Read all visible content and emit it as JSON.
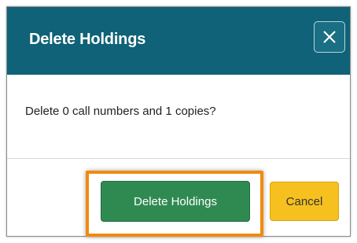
{
  "dialog": {
    "title": "Delete Holdings",
    "message": "Delete 0 call numbers and 1 copies?",
    "close_icon": "close-icon",
    "buttons": {
      "confirm_label": "Delete Holdings",
      "cancel_label": "Cancel"
    }
  },
  "colors": {
    "header_bg": "#0f6277",
    "confirm_bg": "#2f8a52",
    "cancel_bg": "#f6c01f",
    "highlight": "#f08a10"
  }
}
